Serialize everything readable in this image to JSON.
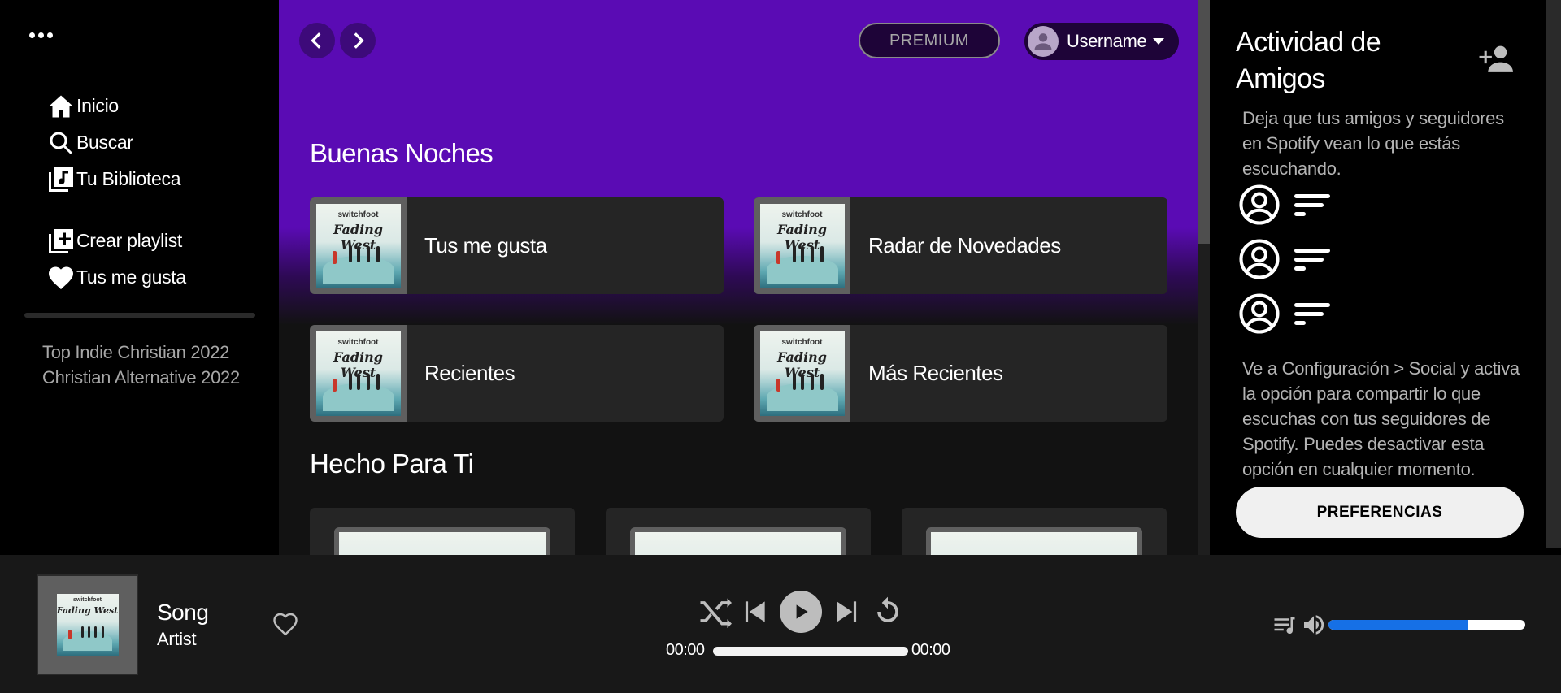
{
  "sidebar": {
    "nav": [
      {
        "label": "Inicio",
        "icon": "home-icon"
      },
      {
        "label": "Buscar",
        "icon": "search-icon"
      },
      {
        "label": "Tu Biblioteca",
        "icon": "library-icon"
      }
    ],
    "actions": [
      {
        "label": "Crear playlist",
        "icon": "add-square-icon"
      },
      {
        "label": "Tus me gusta",
        "icon": "heart-icon"
      }
    ],
    "playlists": [
      "Top Indie Christian 2022",
      "Christian Alternative 2022"
    ]
  },
  "header": {
    "premium_label": "PREMIUM",
    "username": "Username"
  },
  "main": {
    "greeting": "Buenas Noches",
    "cards": [
      {
        "label": "Tus me gusta"
      },
      {
        "label": "Radar de Novedades"
      },
      {
        "label": "Recientes"
      },
      {
        "label": "Más Recientes"
      }
    ],
    "section2_title": "Hecho Para Ti",
    "album_text_top": "switchfoot",
    "album_text_title": "Fading West"
  },
  "friends": {
    "title": "Actividad de Amigos",
    "description": "Deja que tus amigos y seguidores en Spotify vean lo que estás escuchando.",
    "instructions": "Ve a Configuración > Social y activa la opción para compartir lo que escuchas con tus seguidores de Spotify. Puedes desactivar esta opción en cualquier momento.",
    "button_label": "PREFERENCIAS"
  },
  "player": {
    "song": "Song",
    "artist": "Artist",
    "time_elapsed": "00:00",
    "time_total": "00:00",
    "progress_percent": 0,
    "volume_percent": 71,
    "accent_color": "#1670e6"
  }
}
